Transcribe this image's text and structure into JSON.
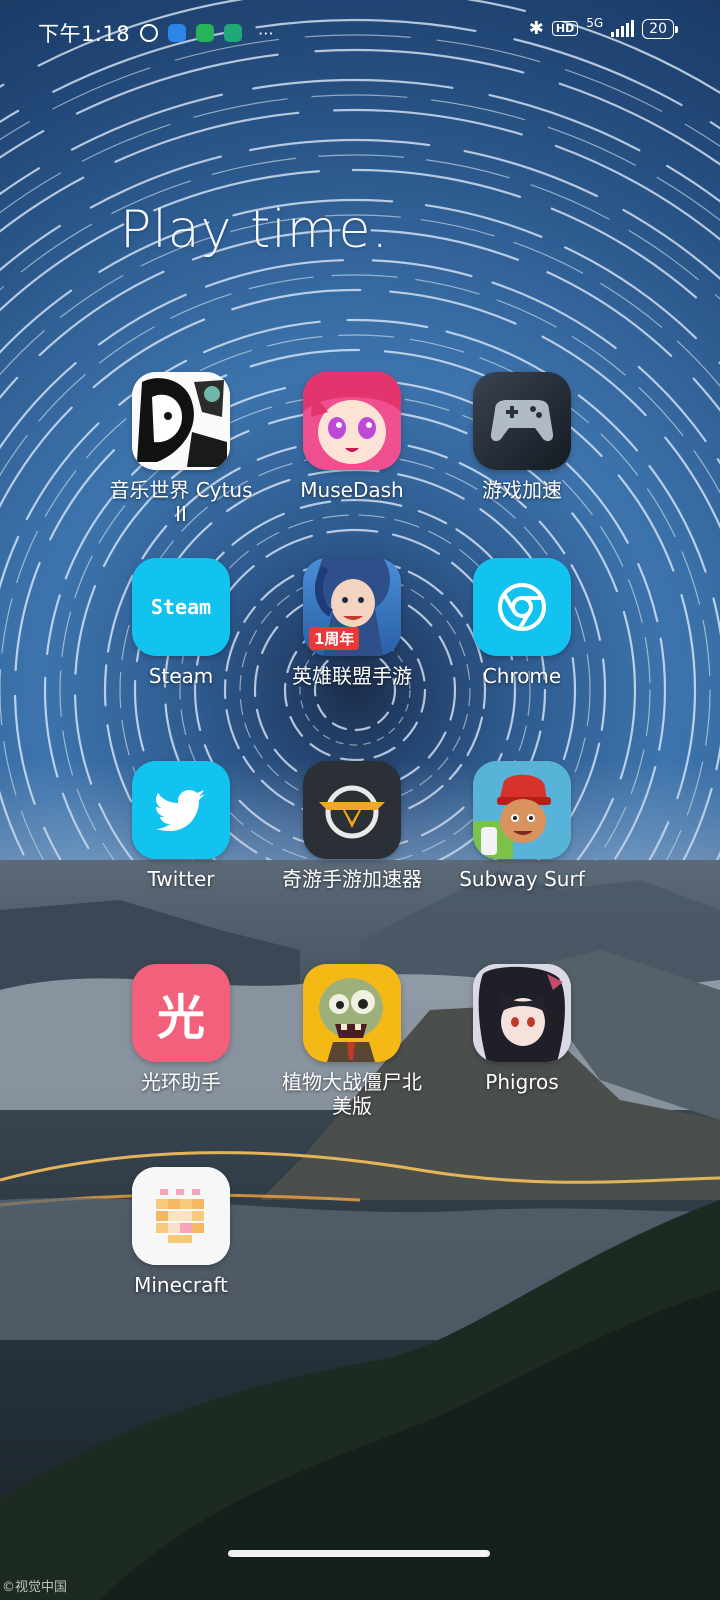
{
  "status_bar": {
    "time": "下午1:18",
    "more_indicator": "···",
    "network": "5G",
    "battery": "20"
  },
  "folder": {
    "title": "Play time."
  },
  "apps": [
    {
      "label": "音乐世界 Cytus II",
      "icon": "cytus-icon"
    },
    {
      "label": "MuseDash",
      "icon": "musedash-icon"
    },
    {
      "label": "游戏加速",
      "icon": "game-controller-icon"
    },
    {
      "label": "Steam",
      "icon": "steam-icon",
      "icon_text": "Steam"
    },
    {
      "label": "英雄联盟手游",
      "icon": "lol-mobile-icon",
      "icon_text": "1周年"
    },
    {
      "label": "Chrome",
      "icon": "chrome-icon"
    },
    {
      "label": "Twitter",
      "icon": "twitter-bird-icon"
    },
    {
      "label": "奇游手游加速器",
      "icon": "qiyou-icon"
    },
    {
      "label": "Subway Surf",
      "icon": "subway-surfers-icon"
    },
    {
      "label": "光环助手",
      "icon": "guanghuan-icon",
      "icon_text": "光"
    },
    {
      "label": "植物大战僵尸北美版",
      "icon": "pvz-zombie-icon"
    },
    {
      "label": "Phigros",
      "icon": "phigros-icon"
    },
    {
      "label": "Minecraft",
      "icon": "minecraft-icon"
    }
  ],
  "watermark": "©视觉中国",
  "colors": {
    "steam_bg": "#12c3ef",
    "chrome_bg": "#12c3ef",
    "twitter_bg": "#12c3ef",
    "guanghuan_bg": "#f2607c",
    "musedash_bg": "#f04e9a"
  }
}
